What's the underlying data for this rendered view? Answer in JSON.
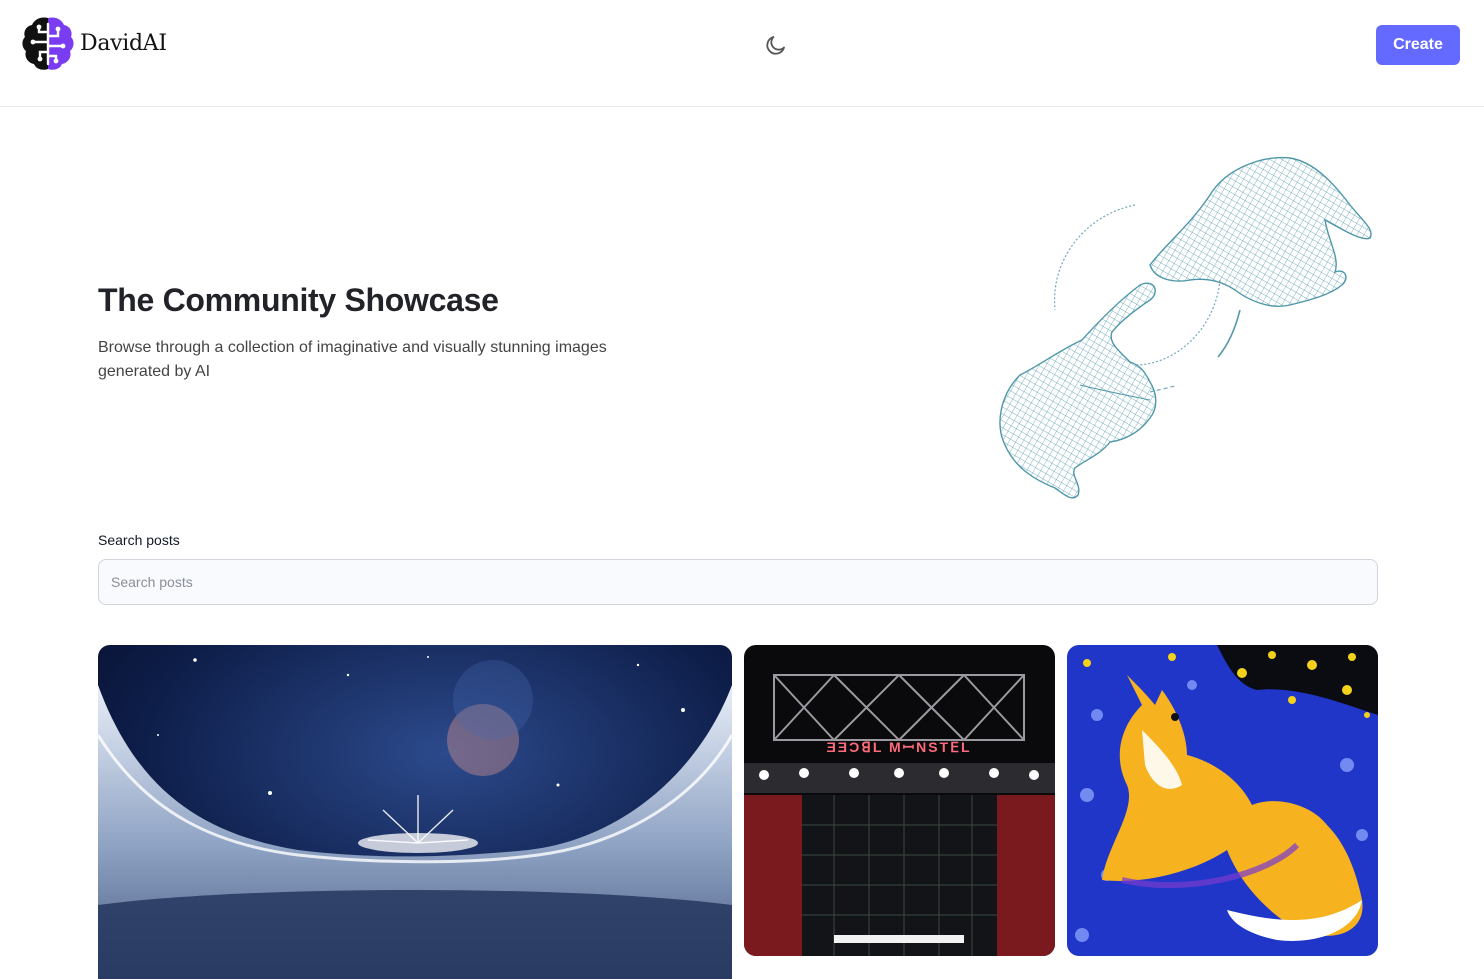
{
  "header": {
    "brand": "DavidAI",
    "logo_icon": "brain-circuit-logo",
    "theme_icon": "moon-icon",
    "create_label": "Create",
    "accent_color": "#6469ff"
  },
  "hero": {
    "title": "The Community Showcase",
    "subtitle": "Browse through a collection of imaginative and visually stunning images generated by AI",
    "illustration": "wireframe-hands-illustration"
  },
  "search": {
    "label": "Search posts",
    "placeholder": "Search posts",
    "value": ""
  },
  "gallery": {
    "cards": [
      {
        "subject": "crystal-stadium-night-sky"
      },
      {
        "subject": "stadium-facade-night",
        "sign_text": "ƎƎƆꓭL MꟷNSTꓰL"
      },
      {
        "subject": "fox-starry-painting"
      }
    ]
  }
}
